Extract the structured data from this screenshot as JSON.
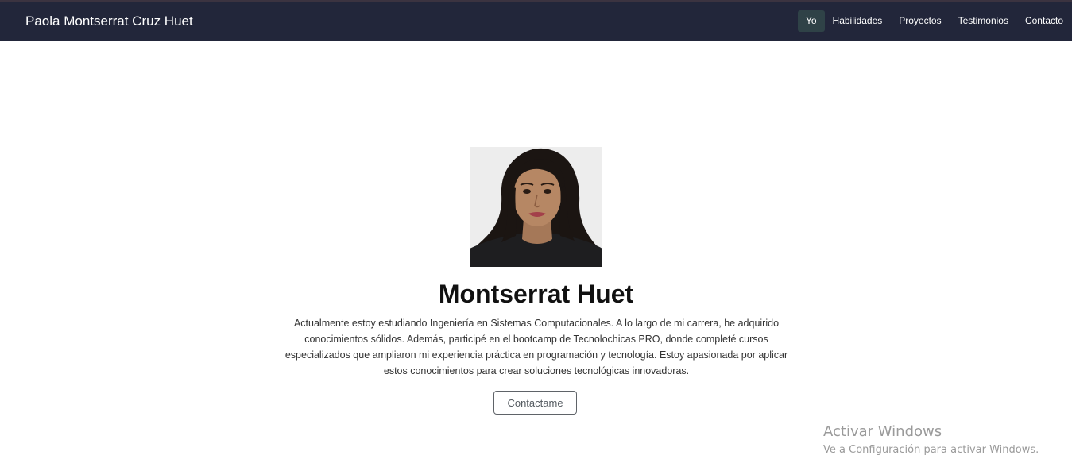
{
  "navbar": {
    "brand": "Paola Montserrat Cruz Huet",
    "links": [
      {
        "label": "Yo",
        "active": true
      },
      {
        "label": "Habilidades",
        "active": false
      },
      {
        "label": "Proyectos",
        "active": false
      },
      {
        "label": "Testimonios",
        "active": false
      },
      {
        "label": "Contacto",
        "active": false
      }
    ]
  },
  "hero": {
    "name": "Montserrat Huet",
    "description": "Actualmente estoy estudiando Ingeniería en Sistemas Computacionales. A lo largo de mi carrera, he adquirido conocimientos sólidos. Además, participé en el bootcamp de Tecnolochicas PRO, donde completé cursos especializados que ampliaron mi experiencia práctica en programación y tecnología. Estoy apasionada por aplicar estos conocimientos para crear soluciones tecnológicas innovadoras.",
    "button_label": "Contactame"
  },
  "watermark": {
    "title": "Activar Windows",
    "subtitle": "Ve a Configuración para activar Windows."
  },
  "colors": {
    "navbar_bg": "#22263a",
    "active_link_bg": "#2f4247",
    "text_dark": "#111111"
  }
}
